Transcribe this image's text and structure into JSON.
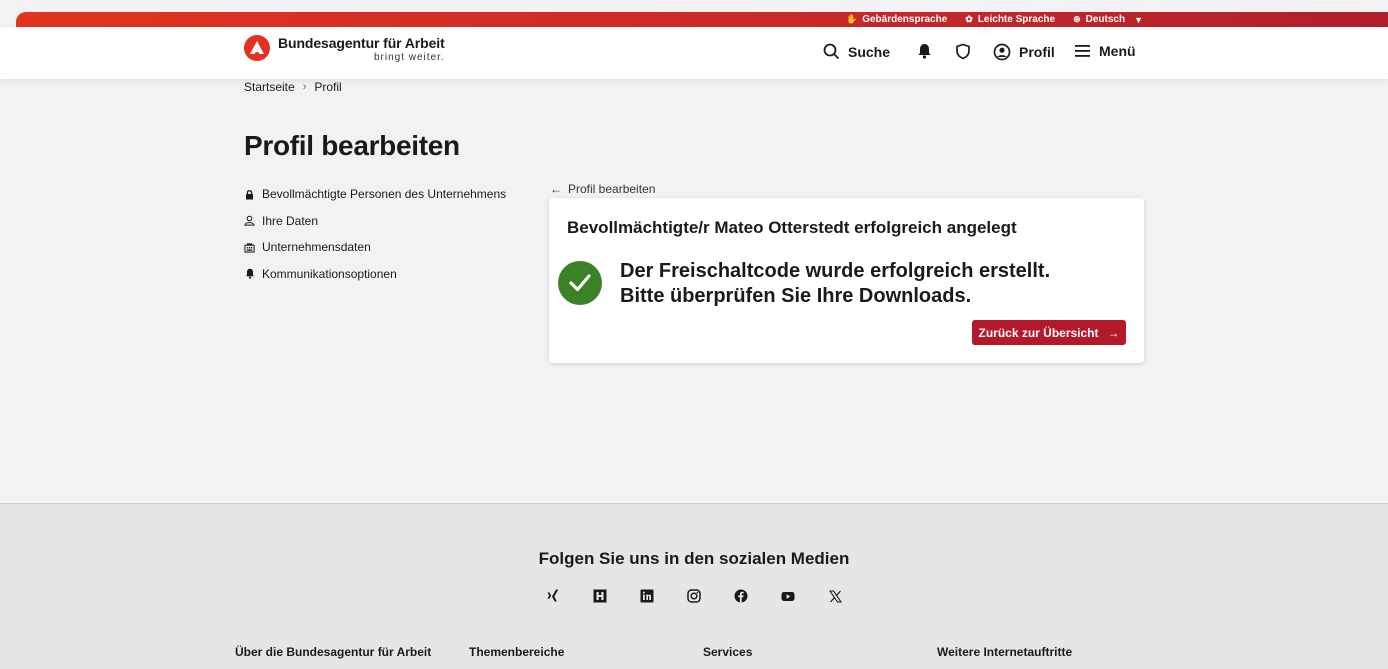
{
  "topbar": {
    "links": [
      {
        "label": "Gebärdensprache",
        "icon": "hand-icon"
      },
      {
        "label": "Leichte Sprache",
        "icon": "easy-language-icon"
      },
      {
        "label": "Deutsch",
        "icon": "globe-icon"
      }
    ]
  },
  "header": {
    "logo_title": "Bundesagentur für Arbeit",
    "logo_subtitle": "bringt weiter.",
    "search_label": "Suche",
    "profile_label": "Profil",
    "menu_label": "Menü"
  },
  "breadcrumb": {
    "items": [
      "Startseite",
      "Profil"
    ]
  },
  "page": {
    "title": "Profil bearbeiten"
  },
  "sidenav": {
    "items": [
      {
        "label": "Bevollmächtigte Personen des Unternehmens",
        "icon": "lock-icon"
      },
      {
        "label": "Ihre Daten",
        "icon": "user-icon"
      },
      {
        "label": "Unternehmensdaten",
        "icon": "building-icon"
      },
      {
        "label": "Kommunikationsoptionen",
        "icon": "bell-icon"
      }
    ]
  },
  "main": {
    "back_link": "Profil bearbeiten",
    "card": {
      "title": "Bevollmächtigte/r Mateo Otterstedt erfolgreich angelegt",
      "message": "Der Freischaltcode wurde erfolgreich erstellt. Bitte überprüfen Sie Ihre Downloads.",
      "button": "Zurück zur Übersicht"
    }
  },
  "footer": {
    "social_heading": "Folgen Sie uns in den sozialen Medien",
    "social_icons": [
      "xing-icon",
      "kununu-icon",
      "linkedin-icon",
      "instagram-icon",
      "facebook-icon",
      "youtube-icon",
      "x-icon"
    ],
    "columns": [
      "Über die Bundesagentur für Arbeit",
      "Themenbereiche",
      "Services",
      "Weitere Internetauftritte"
    ]
  },
  "colors": {
    "brand_red": "#e2311d",
    "button_red": "#b3182b",
    "success_green": "#3b8125"
  }
}
